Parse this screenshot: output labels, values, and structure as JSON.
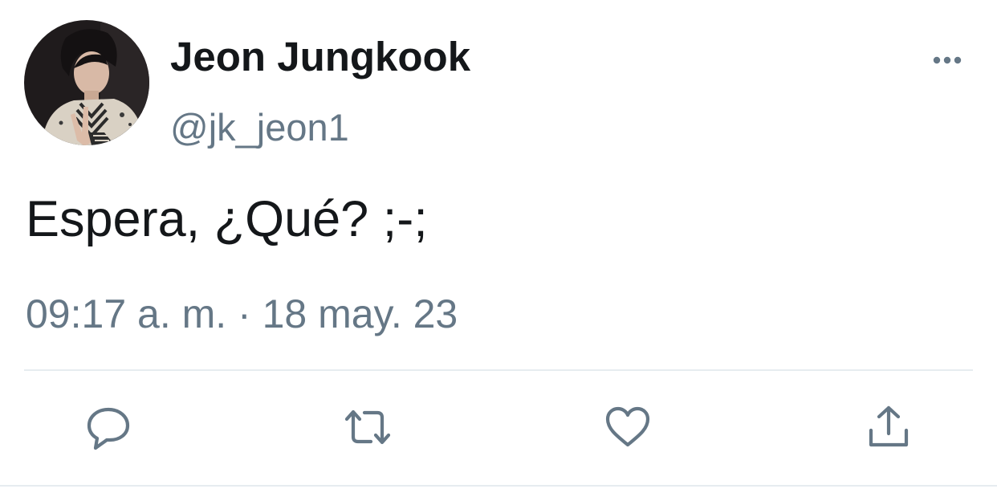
{
  "tweet": {
    "display_name": "Jeon Jungkook",
    "handle": "@jk_jeon1",
    "text": "Espera, ¿Qué? ;-;",
    "timestamp": "09:17 a. m. · 18 may. 23"
  },
  "icons": {
    "more": "more-horizontal-icon",
    "reply": "reply-icon",
    "retweet": "retweet-icon",
    "like": "heart-icon",
    "share": "share-icon"
  },
  "colors": {
    "text_primary": "#14171a",
    "text_secondary": "#657786",
    "divider": "#e6ecf0"
  }
}
